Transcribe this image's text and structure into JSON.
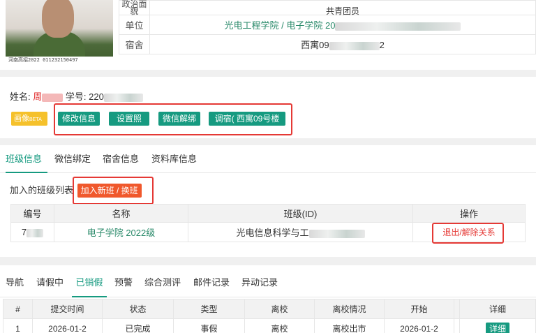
{
  "profile": {
    "photo_caption": "河南高招2022  011232150497",
    "rows": [
      {
        "label": "政治面貌",
        "value": "共青团员"
      },
      {
        "label": "单位",
        "value": "光电工程学院 / 电子学院 20"
      },
      {
        "label": "宿舍",
        "value": "西寓09"
      }
    ],
    "dorm_suffix": "2"
  },
  "student": {
    "name_label": "姓名:",
    "name_value": "周",
    "id_label": "学号:",
    "id_value": "220"
  },
  "actions": {
    "portrait_tag": "画像",
    "portrait_beta": "BETA",
    "edit_info": "修改信息",
    "set_photo": "设置照片",
    "unbind_wechat": "微信解绑",
    "change_dorm": "调宿( 西寓09号楼 )"
  },
  "tabs": [
    "班级信息",
    "微信绑定",
    "宿舍信息",
    "资料库信息"
  ],
  "class_section": {
    "label": "加入的班级列表",
    "join_button": "加入新班 / 换班",
    "headers": [
      "编号",
      "名称",
      "班级(ID)",
      "操作"
    ],
    "rows": [
      {
        "id": "7",
        "name": "电子学院 2022级",
        "class_id": "光电信息科学与工",
        "action": "退出/解除关系"
      }
    ]
  },
  "bottom_tabs": [
    "导航",
    "请假中",
    "已销假",
    "预警",
    "综合测评",
    "邮件记录",
    "异动记录"
  ],
  "leave_table": {
    "headers": [
      "#",
      "提交时间",
      "状态",
      "类型",
      "离校",
      "离校情况",
      "开始",
      "",
      "详细"
    ],
    "rows": [
      {
        "no": "1",
        "submit": "2026-01-2",
        "status": "已完成",
        "type": "事假",
        "leave": "离校",
        "situation": "离校出市",
        "start": "2026-01-2",
        "blank": "",
        "detail": "详细"
      }
    ]
  },
  "colors": {
    "accent": "#169a80",
    "danger": "#e53935",
    "warning": "#f5c12b",
    "orange": "#f0582c"
  }
}
